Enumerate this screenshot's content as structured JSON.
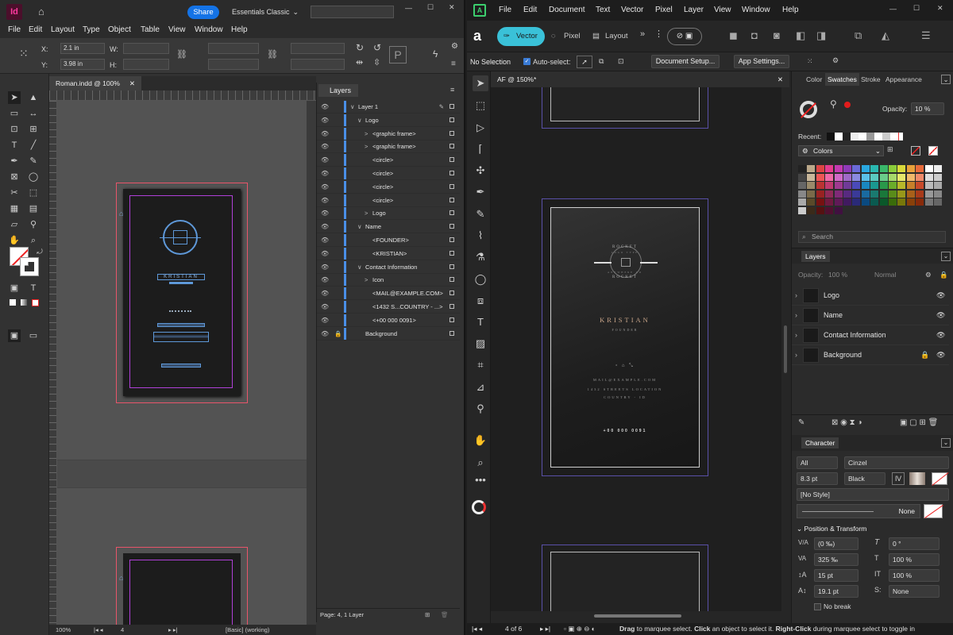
{
  "indesign": {
    "logo": "Id",
    "share_label": "Share",
    "workspace": "Essentials Classic",
    "menu": [
      "File",
      "Edit",
      "Layout",
      "Type",
      "Object",
      "Table",
      "View",
      "Window",
      "Help"
    ],
    "x_label": "X:",
    "x_value": "2.1 in",
    "y_label": "Y:",
    "y_value": "3.98 in",
    "w_label": "W:",
    "h_label": "H:",
    "doc_tab": "Roman.indd @ 100%",
    "layers_title": "Layers",
    "layers": [
      {
        "label": "Layer 1",
        "indent": 0,
        "arrow": "∨"
      },
      {
        "label": "Logo",
        "indent": 1,
        "arrow": "∨"
      },
      {
        "label": "<graphic frame>",
        "indent": 2,
        "arrow": ">"
      },
      {
        "label": "<graphic frame>",
        "indent": 2,
        "arrow": ">"
      },
      {
        "label": "<circle>",
        "indent": 2,
        "arrow": ""
      },
      {
        "label": "<circle>",
        "indent": 2,
        "arrow": ""
      },
      {
        "label": "<circle>",
        "indent": 2,
        "arrow": ""
      },
      {
        "label": "<circle>",
        "indent": 2,
        "arrow": ""
      },
      {
        "label": "Logo",
        "indent": 2,
        "arrow": ">"
      },
      {
        "label": "Name",
        "indent": 1,
        "arrow": "∨"
      },
      {
        "label": "<FOUNDER>",
        "indent": 2,
        "arrow": ""
      },
      {
        "label": "<KRISTIAN>",
        "indent": 2,
        "arrow": ""
      },
      {
        "label": "Contact Information",
        "indent": 1,
        "arrow": "∨"
      },
      {
        "label": "Icon",
        "indent": 2,
        "arrow": ">"
      },
      {
        "label": "<MAIL@EXAMPLE.COM>",
        "indent": 2,
        "arrow": ""
      },
      {
        "label": "<1432 S...COUNTRY - ...>",
        "indent": 2,
        "arrow": ""
      },
      {
        "label": "<+00 000 0091>",
        "indent": 2,
        "arrow": ""
      },
      {
        "label": "Background",
        "indent": 1,
        "arrow": ""
      }
    ],
    "layers_footer": "Page: 4, 1 Layer",
    "zoom": "100%",
    "page": "4",
    "status": "[Basic] (working)",
    "card_name": "KRISTIAN"
  },
  "affinity": {
    "menu": [
      "File",
      "Edit",
      "Document",
      "Text",
      "Vector",
      "Pixel",
      "Layer",
      "View",
      "Window",
      "Help"
    ],
    "personas": {
      "vector": "Vector",
      "pixel": "Pixel",
      "layout": "Layout"
    },
    "context": {
      "selection": "No Selection",
      "autoselect": "Auto-select:",
      "doc_setup": "Document Setup...",
      "app_settings": "App Settings..."
    },
    "doc_tab": "AF @ 150%*",
    "panel_tabs": [
      "Color",
      "Swatches",
      "Stroke",
      "Appearance"
    ],
    "opacity_label": "Opacity:",
    "opacity_value": "10 %",
    "recent_label": "Recent:",
    "palette": "Colors",
    "search_placeholder": "Search",
    "layers_tab": "Layers",
    "layer_opacity_label": "Opacity:",
    "layer_opacity": "100 %",
    "blend": "Normal",
    "layers": [
      "Logo",
      "Name",
      "Contact Information",
      "Background"
    ],
    "character_tab": "Character",
    "char": {
      "scope": "All",
      "font": "Cinzel",
      "size": "8.3 pt",
      "weight": "Black",
      "style": "[No Style]",
      "none": "None"
    },
    "pos_transform": "Position & Transform",
    "transform": {
      "kern": "(0 ‰)",
      "italic": "0 °",
      "track": "325 ‰",
      "hscale": "100 %",
      "leading": "15 pt",
      "vscale": "100 %",
      "baseline": "19.1 pt",
      "caps": "None",
      "nobreak": "No break"
    },
    "pages": "4 of 6",
    "status_hint": {
      "drag": "Drag",
      "drag_text": "to marquee select.",
      "click": "Click",
      "click_text": "an object to select it.",
      "rclick": "Right-Click",
      "rclick_text": "during marquee select to toggle in"
    },
    "card": {
      "ring_top": "ROCKET",
      "ring_mid": "LOGO TYPE",
      "ring_sub": "ANYWHERE CO",
      "ring_bottom": "ROCKET",
      "name": "KRISTIAN",
      "title": "FOUNDER",
      "mail": "MAIL@EXAMPLE.COM",
      "address": "1432 STREETS LOCATION",
      "country": "COUNTRY - ID",
      "phone": "+00 000 0091"
    }
  }
}
